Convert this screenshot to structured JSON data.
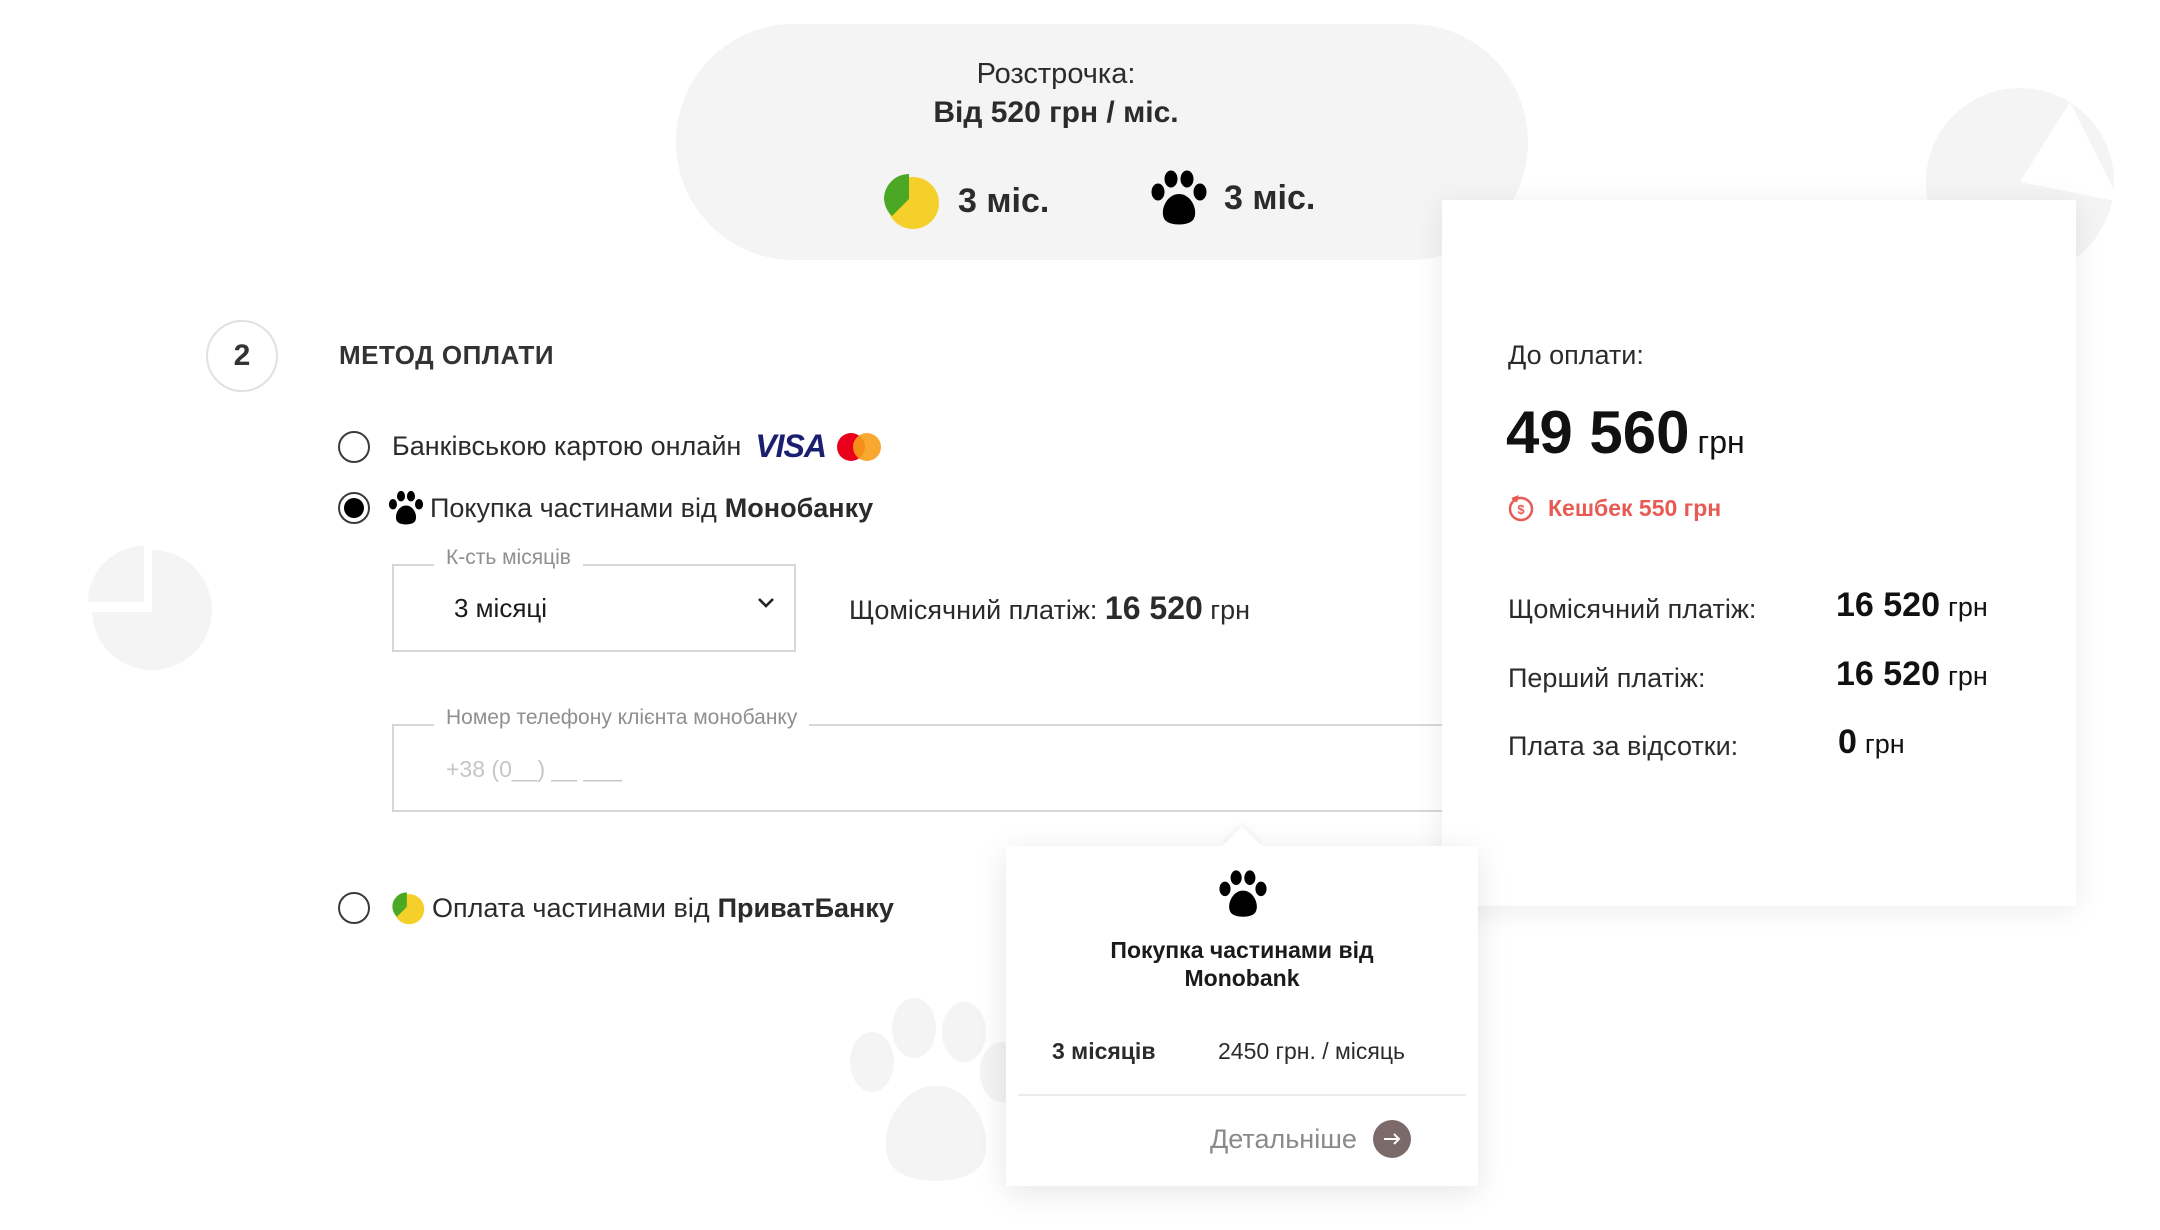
{
  "installment": {
    "title": "Розстрочка:",
    "subtitle": "Від 520 грн / міс.",
    "options": [
      {
        "icon": "privatbank-icon",
        "label": "3 міс."
      },
      {
        "icon": "paw-icon",
        "label": "3 міс."
      }
    ]
  },
  "step": {
    "number": "2",
    "title": "МЕТОД ОПЛАТИ"
  },
  "payment_methods": [
    {
      "label": "Банківською картою онлайн",
      "selected": false,
      "icons": [
        "visa-icon",
        "mastercard-icon"
      ]
    },
    {
      "label_prefix": "Покупка частинами від ",
      "label_bold": "Монобанку",
      "selected": true,
      "icon": "paw-icon"
    },
    {
      "label_prefix": "Оплата частинами від ",
      "label_bold": "ПриватБанку",
      "selected": false,
      "icon": "privatbank-icon"
    }
  ],
  "visa_text": "VISA",
  "months_select": {
    "legend": "К-сть місяців",
    "value": "3 місяці"
  },
  "monthly_inline": {
    "label": "Щомісячний платіж:",
    "value": "16 520",
    "currency": "грн"
  },
  "phone_field": {
    "legend": "Номер телефону клієнта монобанку",
    "placeholder": "+38 (0__) __ ___"
  },
  "summary": {
    "label": "До оплати:",
    "total": "49 560",
    "currency": "грн",
    "cashback": "Кешбек 550 грн",
    "rows": [
      {
        "label": "Щомісячний платіж:",
        "value": "16 520",
        "currency": "грн"
      },
      {
        "label": "Перший платіж:",
        "value": "16 520",
        "currency": "грн"
      },
      {
        "label": "Плата за відсотки:",
        "value": "0",
        "currency": "грн"
      }
    ]
  },
  "tooltip": {
    "title_line1": "Покупка частинами від",
    "title_line2": "Monobank",
    "term": "3 місяців",
    "price": "2450 грн. / місяць",
    "more_label": "Детальніше"
  },
  "colors": {
    "accent_red": "#e85b54",
    "privat_green": "#4aa824",
    "privat_yellow": "#f5d02a",
    "visa_blue": "#1a1f71",
    "mc_red": "#eb001b",
    "mc_orange": "#f79e1b",
    "arrow_button": "#7c6a6a"
  }
}
